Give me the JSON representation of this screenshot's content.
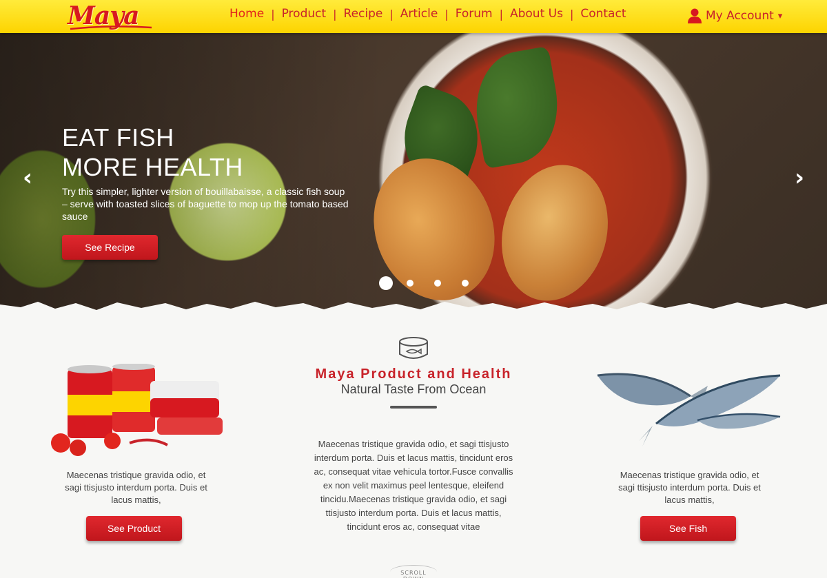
{
  "brand": {
    "logo_text": "Maya",
    "accent": "#d71920",
    "header_bg": "#fdd400"
  },
  "nav": {
    "items": [
      "Home",
      "Product",
      "Recipe",
      "Article",
      "Forum",
      "About Us",
      "Contact"
    ],
    "separator": "|",
    "active": "Home"
  },
  "account": {
    "label": "My Account",
    "icon": "user-icon",
    "caret": "▾"
  },
  "hero": {
    "title_line1": "EAT FISH",
    "title_line2": "MORE HEALTH",
    "description": "Try this simpler, lighter version of bouillabaisse, a classic fish soup – serve with toasted slices of baguette to mop up the tomato based sauce",
    "button_label": "See Recipe",
    "prev_icon": "chevron-left-icon",
    "next_icon": "chevron-right-icon",
    "slides_total": 4,
    "active_slide": 1
  },
  "left_column": {
    "image": "canned-sardines-image",
    "text": "Maecenas tristique gravida odio, et sagi ttisjusto interdum porta. Duis et lacus mattis,",
    "button_label": "See Product"
  },
  "center_column": {
    "icon": "tin-can-icon",
    "title": "Maya Product and Health",
    "subtitle": "Natural Taste From Ocean",
    "text": "Maecenas tristique gravida odio, et sagi ttisjusto interdum porta. Duis et lacus mattis, tincidunt eros ac, consequat vitae vehicula tortor.Fusce convallis ex non velit maximus peel lentesque, eleifend tincidu.Maecenas tristique gravida odio, et sagi ttisjusto interdum porta. Duis et lacus mattis, tincidunt eros ac, consequat vitae"
  },
  "right_column": {
    "image": "sardines-image",
    "text": "Maecenas tristique gravida odio, et sagi ttisjusto interdum porta. Duis et lacus mattis,",
    "button_label": "See Fish"
  },
  "scroll_hint": {
    "label": "SCROLL DOWN"
  }
}
